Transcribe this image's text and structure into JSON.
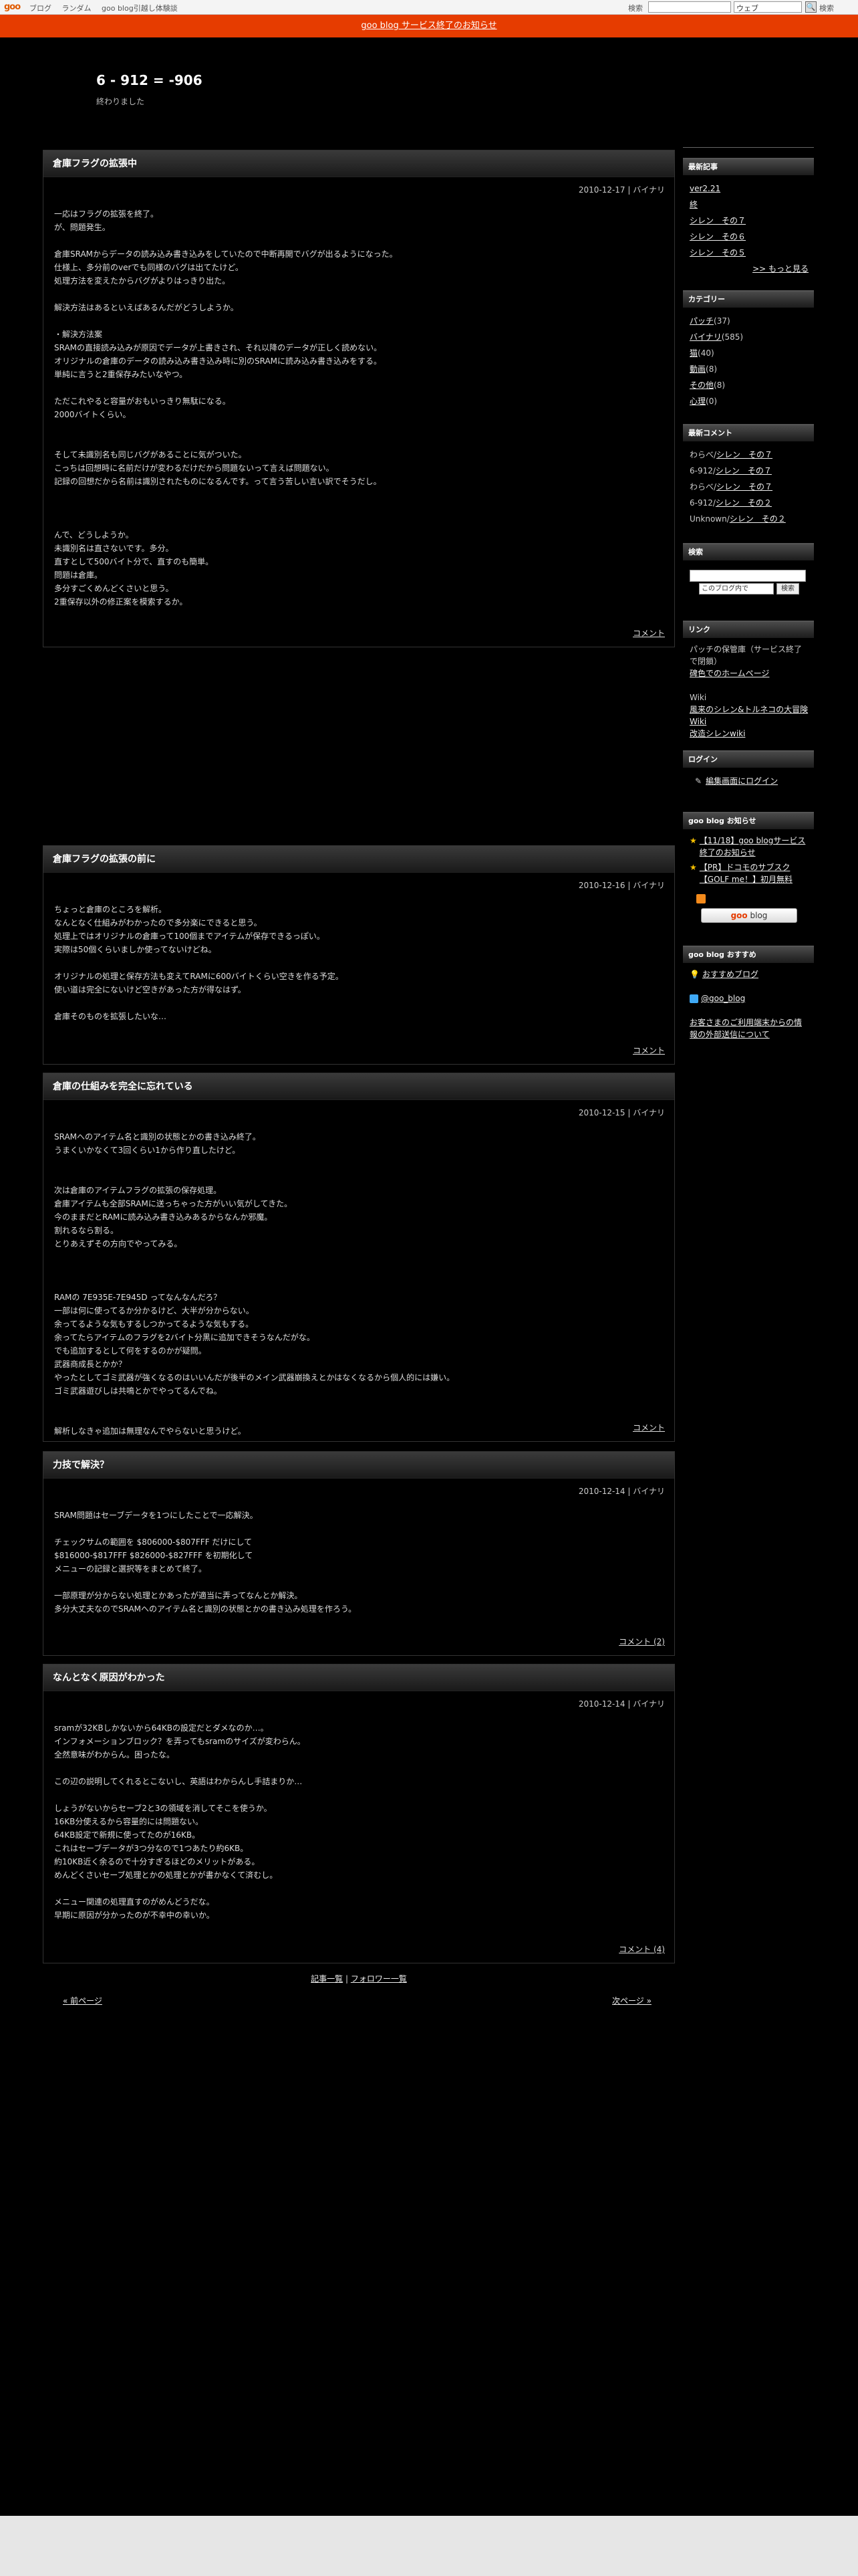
{
  "topbar": {
    "logo": "goo",
    "nav": [
      "ブログ",
      "ランダム",
      "goo blog引越し体験談"
    ],
    "search_label": "検索",
    "search_select": "ウェブ",
    "search_btn": "🔍",
    "search_btn2": "検索"
  },
  "notice": "goo blog サービス終了のお知らせ",
  "blog": {
    "title": "6 - 912 = -906",
    "desc": "終わりました"
  },
  "posts": [
    {
      "title": "倉庫フラグの拡張中",
      "date": "2010-12-17 | バイナリ",
      "comment": "コメント",
      "lines": [
        "一応はフラグの拡張を終了。",
        "が、問題発生。",
        "",
        "倉庫SRAMからデータの読み込み書き込みをしていたので中断再開でバグが出るようになった。",
        "仕様上、多分前のverでも同様のバグは出てたけど。",
        "処理方法を変えたからバグがよりはっきり出た。",
        "",
        "解決方法はあるといえばあるんだがどうしようか。",
        "",
        "・解決方法案",
        "SRAMの直接読み込みが原因でデータが上書きされ、それ以降のデータが正しく読めない。",
        "オリジナルの倉庫のデータの読み込み書き込み時に別のSRAMに読み込み書き込みをする。",
        "単純に言うと2重保存みたいなやつ。",
        "",
        "ただこれやると容量がおもいっきり無駄になる。",
        "2000バイトくらい。",
        "",
        "",
        "そして未識別名も同じバグがあることに気がついた。",
        "こっちは回想時に名前だけが変わるだけだから問題ないって言えば問題ない。",
        "記録の回想だから名前は識別されたものになるんです。って言う苦しい言い訳でそうだし。",
        "",
        "",
        "",
        "んで、どうしようか。",
        "未識別名は直さないです。多分。",
        "直すとして500バイト分で、直すのも簡単。",
        "問題は倉庫。",
        "多分すごくめんどくさいと思う。",
        "2重保存以外の修正案を模索するか。"
      ]
    },
    {
      "title": "倉庫フラグの拡張の前に",
      "date": "2010-12-16 | バイナリ",
      "comment": "コメント",
      "lines": [
        "ちょっと倉庫のところを解析。",
        "なんとなく仕組みがわかったので多分楽にできると思う。",
        "処理上ではオリジナルの倉庫って100個までアイテムが保存できるっぽい。",
        "実際は50個くらいましか使ってないけどね。",
        "",
        "オリジナルの処理と保存方法も変えてRAMに600バイトくらい空きを作る予定。",
        "使い道は完全にないけど空きがあった方が得なはず。",
        "",
        "倉庫そのものを拡張したいな…"
      ]
    },
    {
      "title": "倉庫の仕組みを完全に忘れている",
      "date": "2010-12-15 | バイナリ",
      "comment": "コメント",
      "lines": [
        "SRAMへのアイテム名と識別の状態とかの書き込み終了。",
        "うまくいかなくて3回くらい1から作り直したけど。",
        "",
        "",
        "次は倉庫のアイテムフラグの拡張の保存処理。",
        "倉庫アイテムも全部SRAMに送っちゃった方がいい気がしてきた。",
        "今のままだとRAMに読み込み書き込みあるからなんか邪魔。",
        "割れるなら割る。",
        "とりあえずその方向でやってみる。",
        "",
        "",
        "",
        "RAMの 7E935E-7E945D ってなんなんだろ？",
        "一部は何に使ってるか分かるけど、大半が分からない。",
        "余ってるような気もするしつかってるような気もする。",
        "余ってたらアイテムのフラグを2バイト分黒に追加できそうなんだがな。",
        "でも追加するとして何をするのかが疑問。",
        "武器商成長とかか？",
        "やったとしてゴミ武器が強くなるのはいいんだが後半のメイン武器崩換えとかはなくなるから個人的には嫌い。",
        "ゴミ武器遊びしは共鳴とかでやってるんでね。",
        "",
        "",
        "解析しなきゃ追加は無理なんでやらないと思うけど。"
      ]
    },
    {
      "title": "力技で解決？",
      "date": "2010-12-14 | バイナリ",
      "comment": "コメント (2)",
      "lines": [
        "SRAM問題はセーブデータを1つにしたことで一応解決。",
        "",
        "チェックサムの範囲を $806000-$807FFF だけにして",
        "$816000-$817FFF $826000-$827FFF を初期化して",
        "メニューの記録と選択等をまとめて終了。",
        "",
        "一部原理が分からない処理とかあったが適当に弄ってなんとか解決。",
        "多分大丈夫なのでSRAMへのアイテム名と識別の状態とかの書き込み処理を作ろう。"
      ]
    },
    {
      "title": "なんとなく原因がわかった",
      "date": "2010-12-14 | バイナリ",
      "comment": "コメント (4)",
      "lines": [
        "sramが32KBしかないから64KBの設定だとダメなのか…。",
        "インフォメーションブロック？を弄ってもsramのサイズが変わらん。",
        "全然意味がわからん。困ったな。",
        "",
        "この辺の説明してくれるとこないし、英語はわからんし手詰まりか…",
        "",
        "しょうがないからセーブ2と3の領域を消してそこを使うか。",
        "16KB分使えるから容量的には問題ない。",
        "64KB設定で新規に使ってたのが16KB。",
        "これはセーブデータが3つ分なので1つあたり約6KB。",
        "約10KB近く余るので十分すぎるほどのメリットがある。",
        "めんどくさいセーブ処理とかの処理とかが書かなくて済むし。",
        "",
        "メニュー関連の処理直すのがめんどうだな。",
        "早期に原因が分かったのが不幸中の幸いか。"
      ]
    }
  ],
  "sidebar": {
    "recent_title": "最新記事",
    "recent": [
      "ver2.21",
      "終",
      "シレン　その７",
      "シレン　その６",
      "シレン　その５"
    ],
    "recent_more": ">> もっと見る",
    "cat_title": "カテゴリー",
    "cats": [
      {
        "name": "パッチ",
        "count": "(37)"
      },
      {
        "name": "バイナリ",
        "count": "(585)"
      },
      {
        "name": "猫",
        "count": "(40)"
      },
      {
        "name": "動画",
        "count": "(8)"
      },
      {
        "name": "その他",
        "count": "(8)"
      },
      {
        "name": "心理",
        "count": "(0)"
      }
    ],
    "com_title": "最新コメント",
    "coms": [
      {
        "who": "わらべ/",
        "what": "シレン　その７"
      },
      {
        "who": "6-912/",
        "what": "シレン　その７"
      },
      {
        "who": "わらべ/",
        "what": "シレン　その７"
      },
      {
        "who": "6-912/",
        "what": "シレン　その２"
      },
      {
        "who": "Unknown/",
        "what": "シレン　その２"
      }
    ],
    "search_title": "検索",
    "search_select": "このブログ内で",
    "search_btn": "検索",
    "link_title": "リンク",
    "links_intro": "パッチの保管庫（サービス終了で閉鎖）",
    "links_a": "碑色でのホームページ",
    "links_wiki": "Wiki",
    "links_b": "風来のシレン&トルネコの大冒険 Wiki",
    "links_c": "改造シレンwiki",
    "login_title": "ログイン",
    "login": "編集画面にログイン",
    "info_title": "goo blog お知らせ",
    "info": [
      "【11/18】goo blogサービス終了のお知らせ",
      "【PR】ドコモのサブスク【GOLF me！】初月無料"
    ],
    "goo_btn_a": "goo",
    "goo_btn_b": " blog",
    "rec_title": "goo blog おすすめ",
    "rec": "おすすめブログ",
    "twitter": "@goo_blog",
    "ext": "お客さまのご利用端末からの情報の外部送信について"
  },
  "footer": {
    "list": "記事一覧",
    "sep": " | ",
    "follow": "フォロワー一覧",
    "prev": "« 前ページ",
    "next": "次ページ »"
  }
}
